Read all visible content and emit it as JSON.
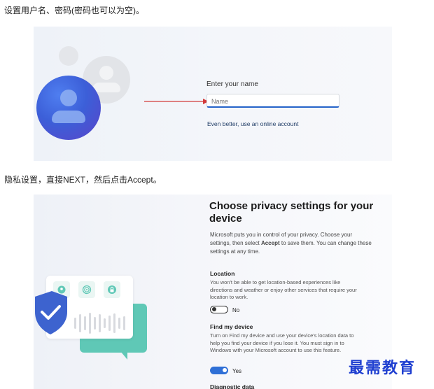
{
  "captions": {
    "setup_user": "设置用户名、密码(密码也可以为空)。",
    "privacy": "隐私设置，直接NEXT，然后点击Accept。"
  },
  "name_screen": {
    "label": "Enter your name",
    "input_placeholder": "Name",
    "online_account_link": "Even better, use an online account"
  },
  "privacy_screen": {
    "title": "Choose privacy settings for your device",
    "intro_part1": "Microsoft puts you in control of your privacy. Choose your settings, then select ",
    "intro_accept": "Accept",
    "intro_part2": " to save them. You can change these settings at any time.",
    "location": {
      "title": "Location",
      "description": "You won't be able to get location-based experiences like directions and weather or enjoy other services that require your location to work.",
      "toggle_state": "off",
      "toggle_label": "No"
    },
    "find_my_device": {
      "title": "Find my device",
      "description": "Turn on Find my device and use your device's location data to help you find your device if you lose it. You must sign in to Windows with your Microsoft account to use this feature.",
      "toggle_state": "on",
      "toggle_label": "Yes"
    },
    "diagnostic": {
      "title": "Diagnostic data"
    }
  },
  "icons": [
    "user-avatar-icon",
    "location-pin-icon",
    "fingerprint-icon",
    "lock-icon",
    "shield-check-icon"
  ],
  "colors": {
    "accent_blue": "#2f6fd6",
    "avatar_blue": "#3c5fd8",
    "teal": "#5fc8b6",
    "arrow_red": "#d23a3a",
    "watermark": "#1f3fd0"
  },
  "watermark": "最需教育"
}
